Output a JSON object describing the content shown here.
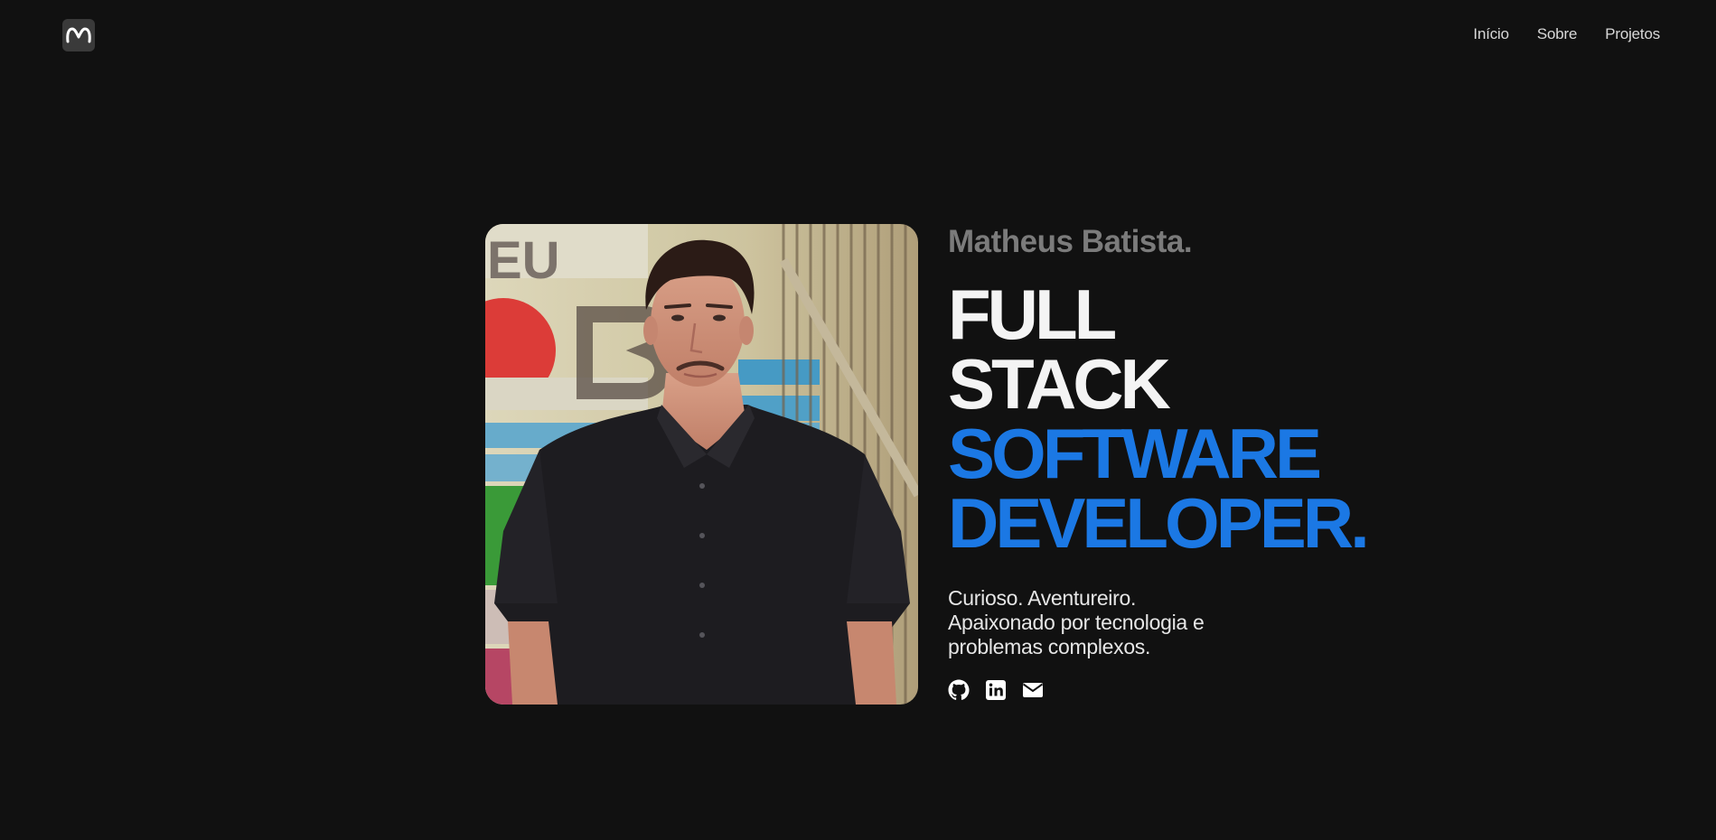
{
  "header": {
    "logo_icon": "m-logo-icon",
    "nav": [
      {
        "label": "Início"
      },
      {
        "label": "Sobre"
      },
      {
        "label": "Projetos"
      }
    ]
  },
  "hero": {
    "photo_alt": "portrait-photo",
    "name": "Matheus Batista.",
    "headline": {
      "line1": "FULL",
      "line2": "STACK",
      "line3": "SOFTWARE",
      "line4": "DEVELOPER."
    },
    "bio": {
      "line1": "Curioso. Aventureiro.",
      "line2": "Apaixonado por tecnologia e",
      "line3": "problemas complexos."
    },
    "socials": [
      {
        "icon": "github-icon"
      },
      {
        "icon": "linkedin-icon"
      },
      {
        "icon": "mail-icon"
      }
    ]
  },
  "colors": {
    "background": "#111111",
    "accent": "#1b78e4",
    "name_gray": "#7b7b7b",
    "headline_white": "#f4f4f4"
  }
}
